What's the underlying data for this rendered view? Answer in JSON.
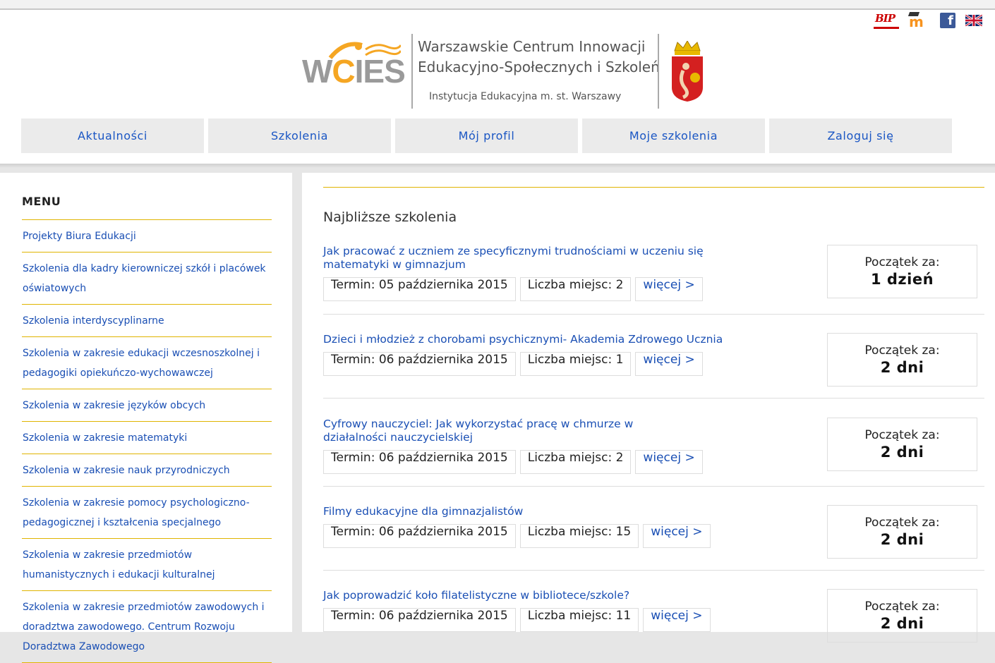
{
  "header": {
    "icons": [
      "bip-icon",
      "moodle-icon",
      "facebook-icon",
      "uk-flag-icon"
    ],
    "bip_text": "BIP",
    "logo": {
      "brand": "WCIES",
      "line1": "Warszawskie Centrum Innowacji",
      "line2": "Edukacyjno-Społecznych i Szkoleń",
      "line3": "Instytucja Edukacyjna m. st. Warszawy"
    }
  },
  "nav": [
    "Aktualności",
    "Szkolenia",
    "Mój profil",
    "Moje szkolenia",
    "Zaloguj się"
  ],
  "sidebar": {
    "title": "MENU",
    "items": [
      "Projekty Biura Edukacji",
      "Szkolenia dla kadry kierowniczej szkół i placówek oświatowych",
      "Szkolenia interdyscyplinarne",
      "Szkolenia w zakresie edukacji wczesnoszkolnej i pedagogiki opiekuńczo-wychowawczej",
      "Szkolenia w zakresie języków obcych",
      "Szkolenia w zakresie matematyki",
      "Szkolenia w zakresie nauk przyrodniczych",
      "Szkolenia w zakresie pomocy psychologiczno-pedagogicznej i kształcenia specjalnego",
      "Szkolenia w zakresie przedmiotów humanistycznych i edukacji kulturalnej",
      "Szkolenia w zakresie przedmiotów zawodowych i doradztwa zawodowego. Centrum Rozwoju Doradztwa Zawodowego"
    ]
  },
  "main": {
    "heading": "Najbliższe szkolenia",
    "start_label": "Początek za:",
    "more_label": "więcej >",
    "courses": [
      {
        "title": "Jak pracować z uczniem ze specyficznymi trudnościami w uczeniu się matematyki w gimnazjum",
        "term": "Termin: 05 października 2015",
        "seats": "Liczba miejsc: 2",
        "start": "1 dzień"
      },
      {
        "title": "Dzieci i młodzież z chorobami psychicznymi- Akademia Zdrowego Ucznia",
        "term": "Termin: 06 października 2015",
        "seats": "Liczba miejsc: 1",
        "start": "2 dni"
      },
      {
        "title": "Cyfrowy nauczyciel: Jak wykorzystać pracę w chmurze w działalności nauczycielskiej",
        "term": "Termin: 06 października 2015",
        "seats": "Liczba miejsc: 2",
        "start": "2 dni"
      },
      {
        "title": "Filmy edukacyjne dla gimnazjalistów",
        "term": "Termin: 06 października 2015",
        "seats": "Liczba miejsc: 15",
        "start": "2 dni"
      },
      {
        "title": "Jak poprowadzić koło filatelistyczne w bibliotece/szkole?",
        "term": "Termin: 06 października 2015",
        "seats": "Liczba miejsc: 11",
        "start": "2 dni"
      }
    ]
  },
  "colors": {
    "link": "#1a4fb4",
    "accent_line": "#e0b400",
    "logo_orange": "#f5a623"
  }
}
